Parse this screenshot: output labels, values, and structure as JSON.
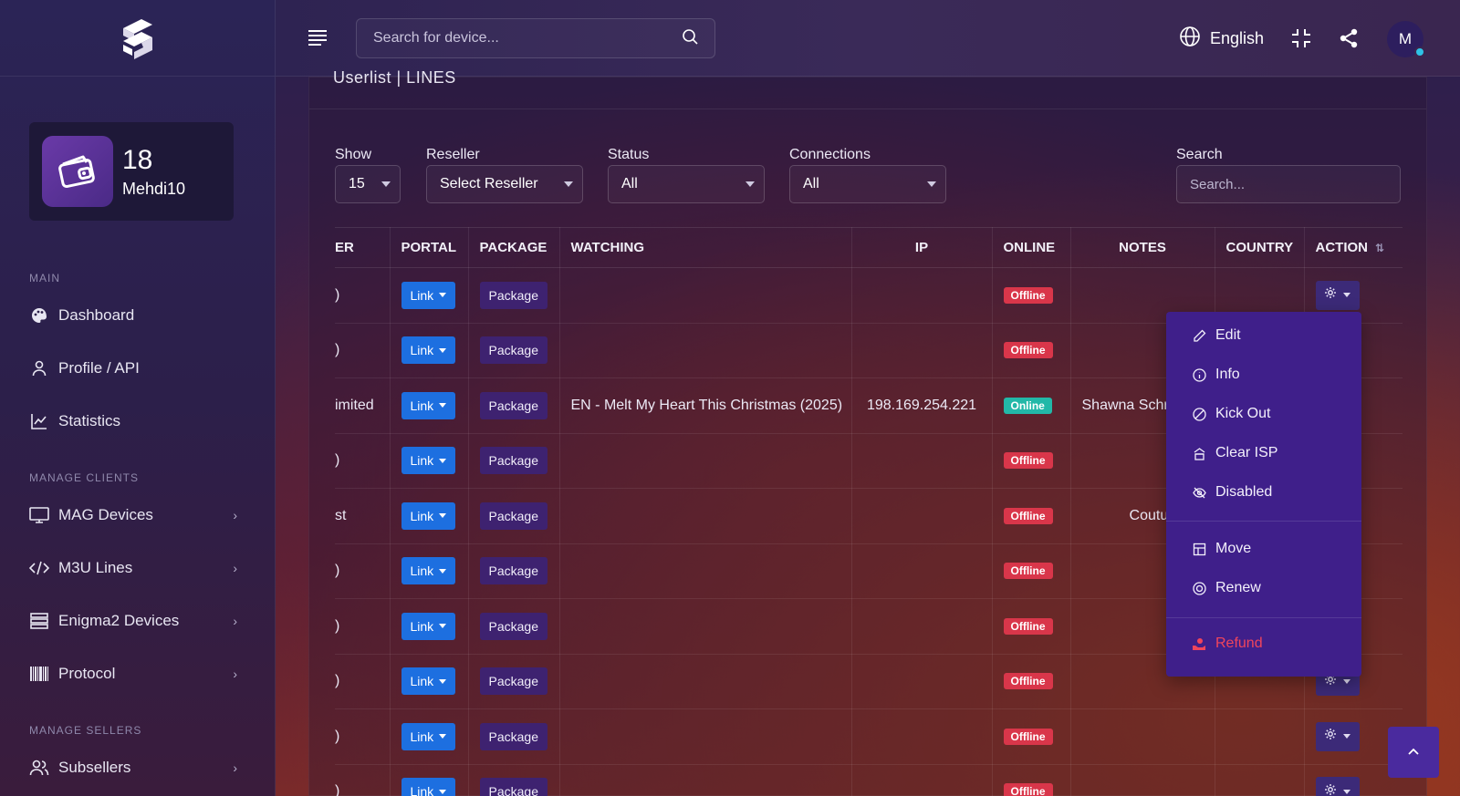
{
  "sidebar": {
    "credit": {
      "count": "18",
      "user": "Mehdi10"
    },
    "sections": {
      "main": "MAIN",
      "manage_clients": "MANAGE CLIENTS",
      "manage_sellers": "MANAGE SELLERS"
    },
    "items": [
      {
        "label": "Dashboard",
        "icon": "palette-icon"
      },
      {
        "label": "Profile / API",
        "icon": "user-icon"
      },
      {
        "label": "Statistics",
        "icon": "chart-line-icon"
      },
      {
        "label": "MAG Devices",
        "icon": "monitor-icon"
      },
      {
        "label": "M3U Lines",
        "icon": "code-icon"
      },
      {
        "label": "Enigma2 Devices",
        "icon": "server-icon"
      },
      {
        "label": "Protocol",
        "icon": "barcode-icon"
      },
      {
        "label": "Subsellers",
        "icon": "users-icon"
      }
    ]
  },
  "topbar": {
    "search_placeholder": "Search for device...",
    "language": "English",
    "avatar_initial": "M"
  },
  "card": {
    "title": "Userlist | LINES",
    "filters": {
      "show_label": "Show",
      "show_value": "15",
      "reseller_label": "Reseller",
      "reseller_value": "Select Reseller",
      "status_label": "Status",
      "status_value": "All",
      "connections_label": "Connections",
      "connections_value": "All",
      "search_label": "Search",
      "search_placeholder": "Search..."
    }
  },
  "table": {
    "headers": [
      "ER",
      "PORTAL",
      "PACKAGE",
      "WATCHING",
      "IP",
      "ONLINE",
      "NOTES",
      "COUNTRY",
      "ACTION"
    ],
    "link_label": "Link",
    "package_label": "Package",
    "rows": [
      {
        "user": ")",
        "watching": "",
        "ip": "",
        "online": "Offline",
        "notes": ""
      },
      {
        "user": ")",
        "watching": "",
        "ip": "",
        "online": "Offline",
        "notes": ""
      },
      {
        "user": "imited",
        "watching": "EN - Melt My Heart This Christmas (2025)",
        "ip": "198.169.254.221",
        "online": "Online",
        "notes": "Shawna Schr"
      },
      {
        "user": ")",
        "watching": "",
        "ip": "",
        "online": "Offline",
        "notes": ""
      },
      {
        "user": "st",
        "watching": "",
        "ip": "",
        "online": "Offline",
        "notes": "Couture"
      },
      {
        "user": ")",
        "watching": "",
        "ip": "",
        "online": "Offline",
        "notes": ""
      },
      {
        "user": ")",
        "watching": "",
        "ip": "",
        "online": "Offline",
        "notes": ""
      },
      {
        "user": ")",
        "watching": "",
        "ip": "",
        "online": "Offline",
        "notes": ""
      },
      {
        "user": ")",
        "watching": "",
        "ip": "",
        "online": "Offline",
        "notes": ""
      },
      {
        "user": ")",
        "watching": "",
        "ip": "",
        "online": "Offline",
        "notes": ""
      }
    ]
  },
  "dropdown": {
    "items": [
      {
        "label": "Edit",
        "icon": "pencil-icon"
      },
      {
        "label": "Info",
        "icon": "info-icon"
      },
      {
        "label": "Kick Out",
        "icon": "ban-icon"
      },
      {
        "label": "Clear ISP",
        "icon": "building-icon"
      },
      {
        "label": "Disabled",
        "icon": "eye-off-icon"
      },
      {
        "label": "Move",
        "icon": "move-icon"
      },
      {
        "label": "Renew",
        "icon": "renew-icon"
      },
      {
        "label": "Refund",
        "icon": "refund-icon"
      }
    ]
  },
  "colors": {
    "link_blue": "#1d6fe0",
    "package_purple": "#3e2270",
    "offline_red": "#d9364a",
    "online_teal": "#22b8a8",
    "dropdown_bg": "#3f1f8a",
    "refund_red": "#f0455c"
  }
}
